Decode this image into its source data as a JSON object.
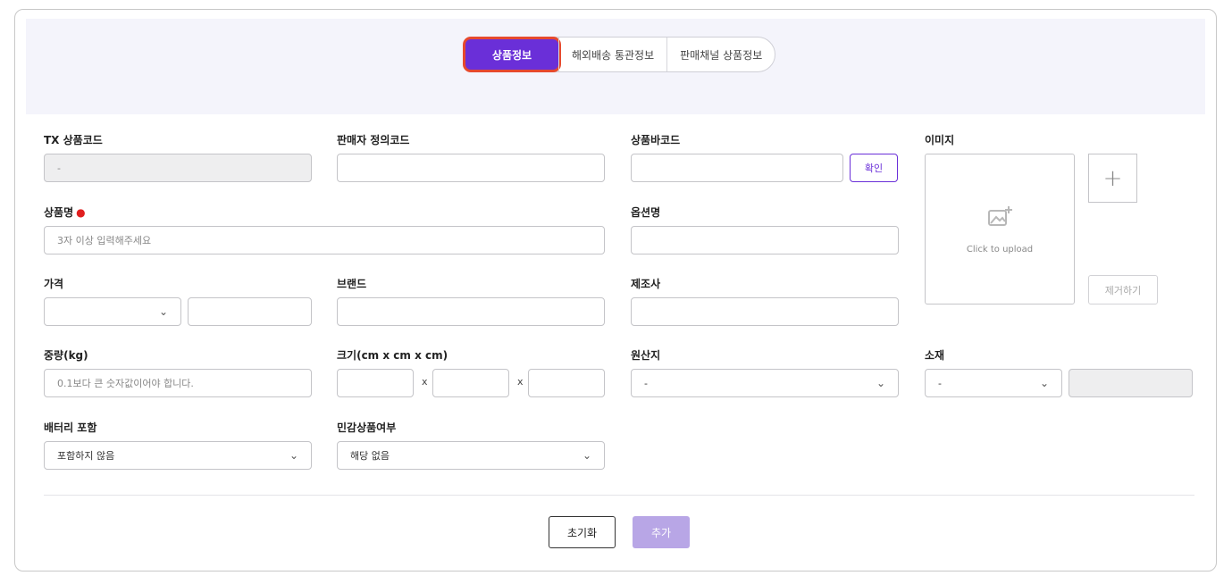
{
  "tabs": [
    {
      "label": "상품정보",
      "active": true
    },
    {
      "label": "해외배송 통관정보",
      "active": false
    },
    {
      "label": "판매채널 상품정보",
      "active": false
    }
  ],
  "fields": {
    "tx_code": {
      "label": "TX 상품코드",
      "value": "-"
    },
    "seller_code": {
      "label": "판매자 정의코드",
      "value": ""
    },
    "barcode": {
      "label": "상품바코드",
      "value": "",
      "confirm_label": "확인"
    },
    "image": {
      "label": "이미지",
      "upload_text": "Click to upload",
      "plus": "+",
      "remove_label": "제거하기"
    },
    "product_name": {
      "label": "상품명",
      "required_mark": "●",
      "placeholder": "3자 이상 입력해주세요"
    },
    "option_name": {
      "label": "옵션명",
      "value": ""
    },
    "price": {
      "label": "가격",
      "currency": "",
      "amount": ""
    },
    "brand": {
      "label": "브랜드",
      "value": ""
    },
    "manufacturer": {
      "label": "제조사",
      "value": ""
    },
    "weight": {
      "label": "중량(kg)",
      "placeholder": "0.1보다 큰 숫자값이어야 합니다."
    },
    "size": {
      "label": "크기(cm x cm x cm)",
      "sep": "x"
    },
    "origin": {
      "label": "원산지",
      "value": "-"
    },
    "material": {
      "label": "소재",
      "value": "-",
      "extra": ""
    },
    "battery": {
      "label": "배터리 포함",
      "value": "포함하지 않음"
    },
    "sensitive": {
      "label": "민감상품여부",
      "value": "해당 없음"
    }
  },
  "actions": {
    "reset": "초기화",
    "add": "추가"
  },
  "colors": {
    "accent": "#6a2fd8",
    "highlight": "#e6492d",
    "disabled_add": "#b8a6e6"
  }
}
